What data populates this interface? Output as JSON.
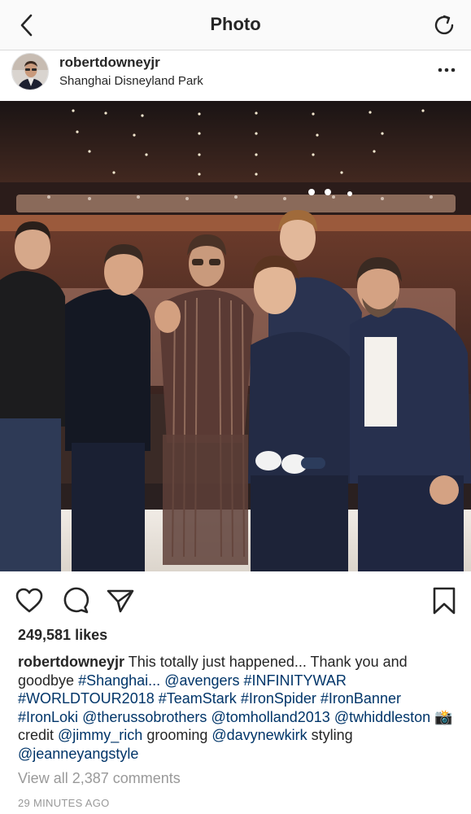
{
  "nav": {
    "title": "Photo",
    "back_icon": "chevron-left-icon",
    "refresh_icon": "refresh-icon"
  },
  "post": {
    "username": "robertdowneyjr",
    "location": "Shanghai Disneyland Park",
    "more_icon": "more-horizontal-icon"
  },
  "photo": {
    "description_icon": "post-photo"
  },
  "actions": {
    "like_icon": "heart-icon",
    "comment_icon": "comment-icon",
    "share_icon": "send-icon",
    "save_icon": "bookmark-icon"
  },
  "likes": "249,581 likes",
  "caption": {
    "username": "robertdowneyjr",
    "segments": [
      {
        "t": "This totally just happened... Thank you and goodbye ",
        "link": false
      },
      {
        "t": "#Shanghai...",
        "link": true
      },
      {
        "t": " ",
        "link": false
      },
      {
        "t": "@avengers",
        "link": true
      },
      {
        "t": " ",
        "link": false
      },
      {
        "t": "#INFINITYWAR",
        "link": true
      },
      {
        "t": " ",
        "link": false
      },
      {
        "t": "#WORLDTOUR2018",
        "link": true
      },
      {
        "t": " ",
        "link": false
      },
      {
        "t": "#TeamStark",
        "link": true
      },
      {
        "t": " ",
        "link": false
      },
      {
        "t": "#IronSpider",
        "link": true
      },
      {
        "t": " ",
        "link": false
      },
      {
        "t": "#IronBanner",
        "link": true
      },
      {
        "t": " ",
        "link": false
      },
      {
        "t": "#IronLoki",
        "link": true
      },
      {
        "t": " ",
        "link": false
      },
      {
        "t": "@therussobrothers",
        "link": true
      },
      {
        "t": " ",
        "link": false
      },
      {
        "t": "@tomholland2013",
        "link": true
      },
      {
        "t": " ",
        "link": false
      },
      {
        "t": "@twhiddleston",
        "link": true
      },
      {
        "t": " 📸credit ",
        "link": false
      },
      {
        "t": "@jimmy_rich",
        "link": true
      },
      {
        "t": " grooming ",
        "link": false
      },
      {
        "t": "@davynewkirk",
        "link": true
      },
      {
        "t": " styling ",
        "link": false
      },
      {
        "t": "@jeanneyangstyle",
        "link": true
      }
    ]
  },
  "comments_link": "View all 2,387 comments",
  "timestamp": "29 MINUTES AGO",
  "colors": {
    "link": "#003569",
    "muted": "#999999",
    "text": "#262626"
  }
}
